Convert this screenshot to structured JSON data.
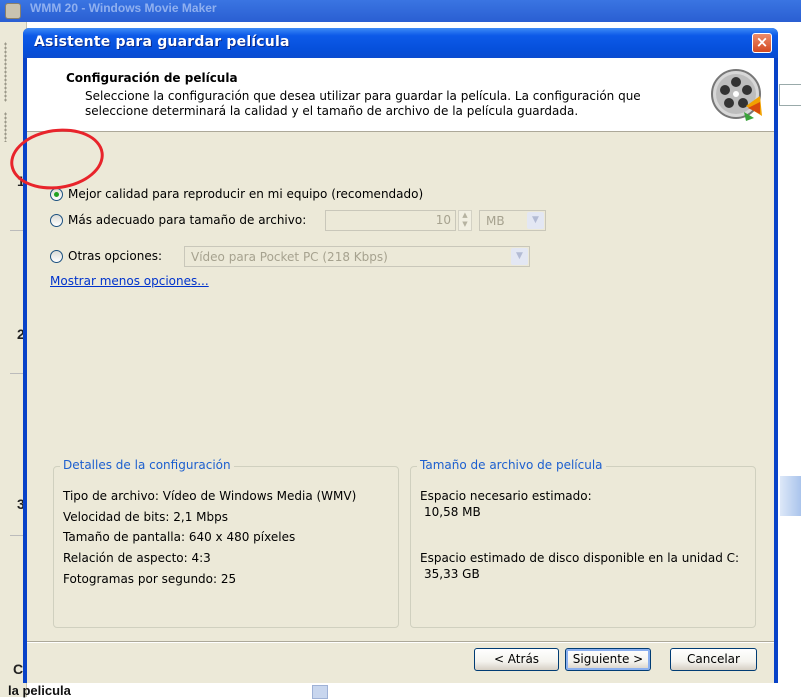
{
  "background": {
    "title": "WMM 20 - Windows Movie Maker",
    "side_numbers": [
      "1",
      "2",
      "3"
    ],
    "bottom_char": "C",
    "bottom_text": "la pelicula"
  },
  "dialog": {
    "title": "Asistente para guardar película",
    "close_icon": "close-icon"
  },
  "header": {
    "title": "Configuración de película",
    "description": "Seleccione la configuración que desea utilizar para guardar la película. La configuración que seleccione determinará la calidad y el tamaño de archivo de la película guardada.",
    "icon": "movie-maker-film-icon"
  },
  "options": {
    "best_quality": {
      "label": "Mejor calidad para reproducir en mi equipo (recomendado)",
      "checked": true
    },
    "best_fit_size": {
      "label": "Más adecuado para tamaño de archivo:",
      "checked": false,
      "value": "10",
      "unit": "MB"
    },
    "other": {
      "label": "Otras opciones:",
      "checked": false,
      "selected": "Vídeo para Pocket PC (218 Kbps)"
    },
    "less_options_link": "Mostrar menos opciones..."
  },
  "details": {
    "legend": "Detalles de la configuración",
    "file_type": "Tipo de archivo: Vídeo de Windows Media (WMV)",
    "bitrate": "Velocidad de bits: 2,1 Mbps",
    "resolution": "Tamaño de pantalla: 640 x 480 píxeles",
    "aspect": "Relación de aspecto: 4:3",
    "fps": "Fotogramas por segundo: 25"
  },
  "file_size": {
    "legend": "Tamaño de archivo de película",
    "estimated_label": "Espacio necesario estimado:",
    "estimated_value": "10,58 MB",
    "disk_label": "Espacio estimado de disco disponible en la unidad C:",
    "disk_value": "35,33 GB"
  },
  "buttons": {
    "back": "< Atrás",
    "next": "Siguiente >",
    "cancel": "Cancelar"
  },
  "colors": {
    "titlebar": "#0a56e0",
    "client": "#ece9d8",
    "link": "#0033cc",
    "group_legend": "#1c5fcf",
    "annotation": "#e8242b"
  }
}
